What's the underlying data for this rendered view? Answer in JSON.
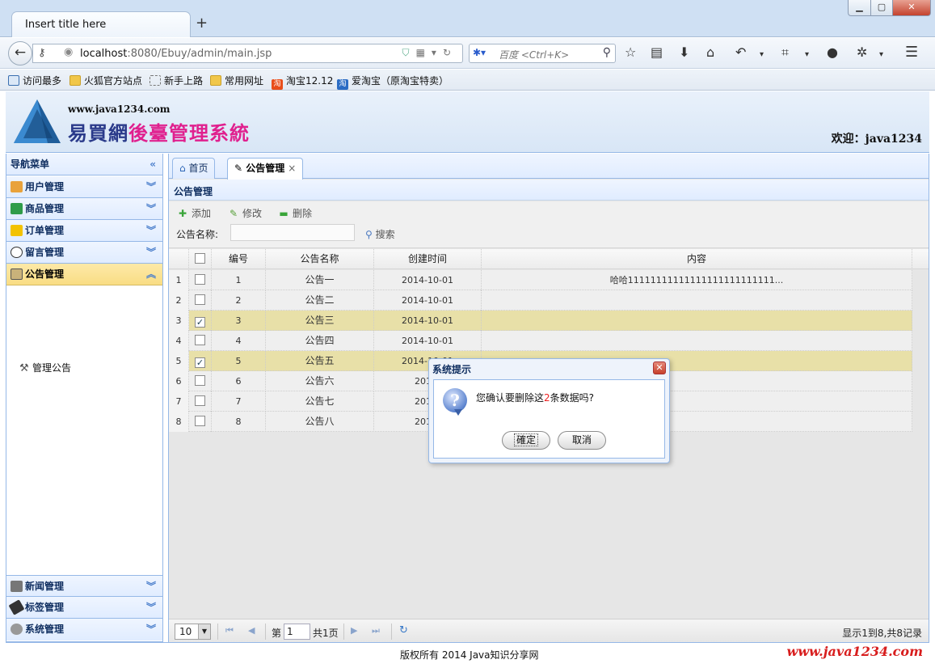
{
  "browser": {
    "tab_title": "Insert title here",
    "new_tab": "+",
    "url_host": "localhost",
    "url_rest": ":8080/Ebuy/admin/main.jsp",
    "search_placeholder": "百度 <Ctrl+K>",
    "bookmarks": [
      {
        "label": "访问最多",
        "icon": "most-visited-icon"
      },
      {
        "label": "火狐官方站点",
        "icon": "folder-icon"
      },
      {
        "label": "新手上路",
        "icon": "dashed-folder-icon"
      },
      {
        "label": "常用网址",
        "icon": "folder-icon"
      },
      {
        "label": "淘宝12.12",
        "icon": "taobao-icon",
        "glyph": "淘"
      },
      {
        "label": "爱淘宝（原淘宝特卖）",
        "icon": "aitaobao-icon",
        "glyph": "淘"
      }
    ]
  },
  "header": {
    "logo_url": "www.java1234.com",
    "title_part1": "易買網",
    "title_part2": "後臺管理系統",
    "welcome": "欢迎：java1234"
  },
  "sidebar": {
    "title": "导航菜单",
    "collapse_glyph": "«",
    "items": [
      {
        "label": "用户管理",
        "icon": "users-icon"
      },
      {
        "label": "商品管理",
        "icon": "product-list-icon"
      },
      {
        "label": "订单管理",
        "icon": "order-icon"
      },
      {
        "label": "留言管理",
        "icon": "comment-icon"
      },
      {
        "label": "公告管理",
        "icon": "notice-icon",
        "selected": true
      },
      {
        "label": "新闻管理",
        "icon": "news-icon"
      },
      {
        "label": "标签管理",
        "icon": "tag-icon"
      },
      {
        "label": "系统管理",
        "icon": "gear-icon"
      }
    ],
    "sub_item": "管理公告"
  },
  "tabs": [
    {
      "label": "首页",
      "icon": "home-icon"
    },
    {
      "label": "公告管理",
      "icon": "notice-icon",
      "close": "×",
      "active": true
    }
  ],
  "panel": {
    "title": "公告管理",
    "toolbar": {
      "add": "添加",
      "edit": "修改",
      "delete": "删除"
    },
    "search_label": "公告名称:",
    "search_value": "",
    "search_button": "搜索"
  },
  "grid": {
    "columns": [
      "编号",
      "公告名称",
      "创建时间",
      "内容"
    ],
    "rows": [
      {
        "rn": "1",
        "id": "1",
        "name": "公告一",
        "time": "2014-10-01",
        "content": "哈哈11111111111111111111111111...",
        "checked": false
      },
      {
        "rn": "2",
        "id": "2",
        "name": "公告二",
        "time": "2014-10-01",
        "content": "",
        "checked": false
      },
      {
        "rn": "3",
        "id": "3",
        "name": "公告三",
        "time": "2014-10-01",
        "content": "",
        "checked": true
      },
      {
        "rn": "4",
        "id": "4",
        "name": "公告四",
        "time": "2014-10-01",
        "content": "",
        "checked": false
      },
      {
        "rn": "5",
        "id": "5",
        "name": "公告五",
        "time": "2014-10-01",
        "content": "",
        "checked": true
      },
      {
        "rn": "6",
        "id": "6",
        "name": "公告六",
        "time": "2014-",
        "content": "",
        "checked": false
      },
      {
        "rn": "7",
        "id": "7",
        "name": "公告七",
        "time": "2014-",
        "content": "",
        "checked": false
      },
      {
        "rn": "8",
        "id": "8",
        "name": "公告八",
        "time": "2014-",
        "content": "",
        "checked": false
      }
    ]
  },
  "pager": {
    "page_size": "10",
    "page_label": "第",
    "page_value": "1",
    "total_pages": "共1页",
    "info": "显示1到8,共8记录"
  },
  "footer": {
    "copyright": "版权所有 2014 Java知识分享网",
    "logo": "www.java1234.com"
  },
  "dialog": {
    "title": "系统提示",
    "msg_before": "您确认要删除这",
    "msg_count": "2",
    "msg_after": "条数据吗?",
    "ok": "確定",
    "cancel": "取消"
  }
}
